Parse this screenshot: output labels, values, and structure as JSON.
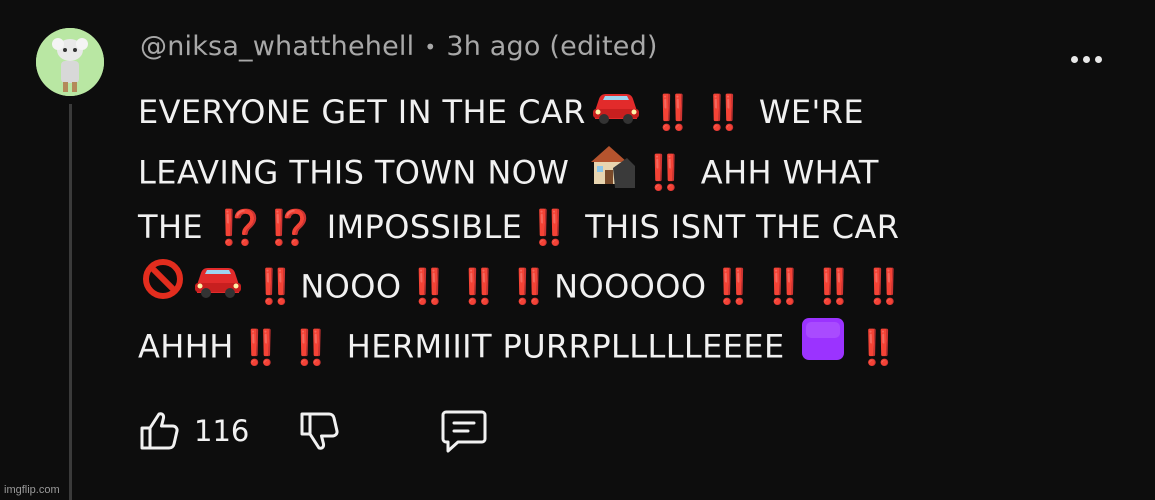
{
  "comment": {
    "author": "@niksa_whatthehell",
    "separator": "•",
    "time": "3h ago",
    "edited": "(edited)",
    "lines": [
      [
        {
          "type": "text",
          "value": "EVERYONE GET IN THE CAR"
        },
        {
          "type": "icon",
          "icon": "car-icon"
        },
        {
          "type": "text",
          "value": "‼️ ‼️",
          "red": true
        },
        {
          "type": "text",
          "value": " WE'RE"
        }
      ],
      [
        {
          "type": "text",
          "value": "LEAVING THIS TOWN NOW "
        },
        {
          "type": "icon",
          "icon": "house-icon"
        },
        {
          "type": "text",
          "value": "‼️",
          "red": true
        },
        {
          "type": "text",
          "value": " AHH WHAT"
        }
      ],
      [
        {
          "type": "text",
          "value": "THE "
        },
        {
          "type": "text",
          "value": "⁉️ ⁉️",
          "red": true
        },
        {
          "type": "text",
          "value": " IMPOSSIBLE"
        },
        {
          "type": "text",
          "value": "‼️",
          "red": true
        },
        {
          "type": "text",
          "value": " THIS ISNT THE CAR"
        }
      ],
      [
        {
          "type": "icon",
          "icon": "prohibited-icon"
        },
        {
          "type": "icon",
          "icon": "car-icon"
        },
        {
          "type": "text",
          "value": "‼️",
          "red": true
        },
        {
          "type": "text",
          "value": "NOOO"
        },
        {
          "type": "text",
          "value": "‼️ ‼️ ‼️",
          "red": true
        },
        {
          "type": "text",
          "value": "NOOOOO"
        },
        {
          "type": "text",
          "value": "‼️ ‼️ ‼️ ‼️",
          "red": true
        }
      ],
      [
        {
          "type": "text",
          "value": "AHHH"
        },
        {
          "type": "text",
          "value": "‼️ ‼️",
          "red": true
        },
        {
          "type": "text",
          "value": " HERMIIIT PURRPLLLLLEEEE "
        },
        {
          "type": "icon",
          "icon": "purple-square-icon"
        },
        {
          "type": "text",
          "value": "‼️",
          "red": true
        }
      ]
    ]
  },
  "actions": {
    "like_count": "116"
  },
  "colors": {
    "background": "#0d0d0d",
    "text": "#f1f1f1",
    "muted": "#a8a8a8",
    "exclamation": "#e32d1e",
    "purple_square": "#9b33ff"
  },
  "watermark": "imgflip.com"
}
